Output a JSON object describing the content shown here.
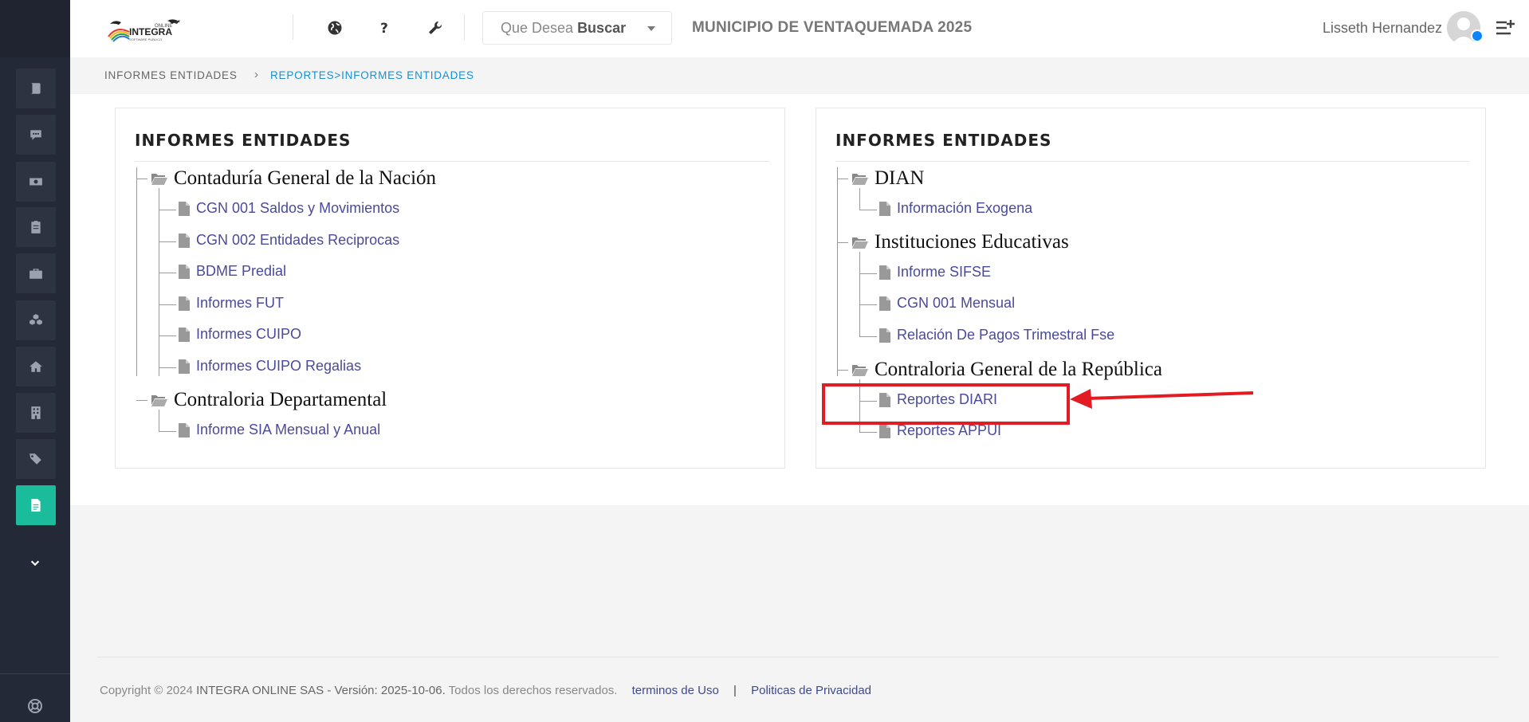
{
  "header": {
    "search_placeholder": "Que Desea",
    "search_emphasis": "Buscar",
    "municipality_title": "MUNICIPIO DE VENTAQUEMADA 2025",
    "user_name": "Lisseth Hernandez",
    "icons": [
      "globe-icon",
      "help-icon",
      "wrench-icon",
      "menu-add-icon"
    ]
  },
  "breadcrumb": {
    "home": "INFORMES ENTIDADES",
    "separator": "›",
    "current": "REPORTES>INFORMES ENTIDADES"
  },
  "sidebar": {
    "items": [
      "book-icon",
      "chat-icon",
      "money-icon",
      "clipboard-icon",
      "briefcase-icon",
      "cubes-icon",
      "home-icon",
      "building-icon",
      "tags-icon",
      "file-icon"
    ],
    "active_item": "file-icon",
    "active_color": "#1abc9c"
  },
  "panels": [
    {
      "title": "INFORMES ENTIDADES",
      "folders": [
        {
          "name": "Contaduría General de la Nación",
          "items": [
            "CGN 001 Saldos y Movimientos",
            "CGN 002 Entidades Reciprocas",
            "BDME Predial",
            "Informes FUT",
            "Informes CUIPO",
            "Informes CUIPO Regalias"
          ]
        },
        {
          "name": "Contraloria Departamental",
          "items": [
            "Informe SIA Mensual y Anual"
          ]
        }
      ]
    },
    {
      "title": "INFORMES ENTIDADES",
      "folders": [
        {
          "name": "DIAN",
          "items": [
            "Información Exogena"
          ]
        },
        {
          "name": "Instituciones Educativas",
          "items": [
            "Informe SIFSE",
            "CGN 001 Mensual",
            "Relación De Pagos Trimestral Fse"
          ]
        },
        {
          "name": "Contraloria General de la República",
          "items": [
            "Reportes DIARI",
            "Reportes APPUI"
          ]
        }
      ]
    }
  ],
  "annotation": {
    "highlighted_item": "Reportes DIARI",
    "color": "#e31b23"
  },
  "footer": {
    "copyright": "Copyright © 2024",
    "company": "INTEGRA ONLINE SAS - Versión: 2025-10-06.",
    "rights": "Todos los derechos reservados.",
    "terms": "terminos de Uso",
    "separator": "|",
    "privacy": "Politicas de Privacidad"
  },
  "colors": {
    "sidebar_bg": "#232936",
    "link": "#4a4a9a",
    "breadcrumb_active": "#1a8fd2"
  }
}
